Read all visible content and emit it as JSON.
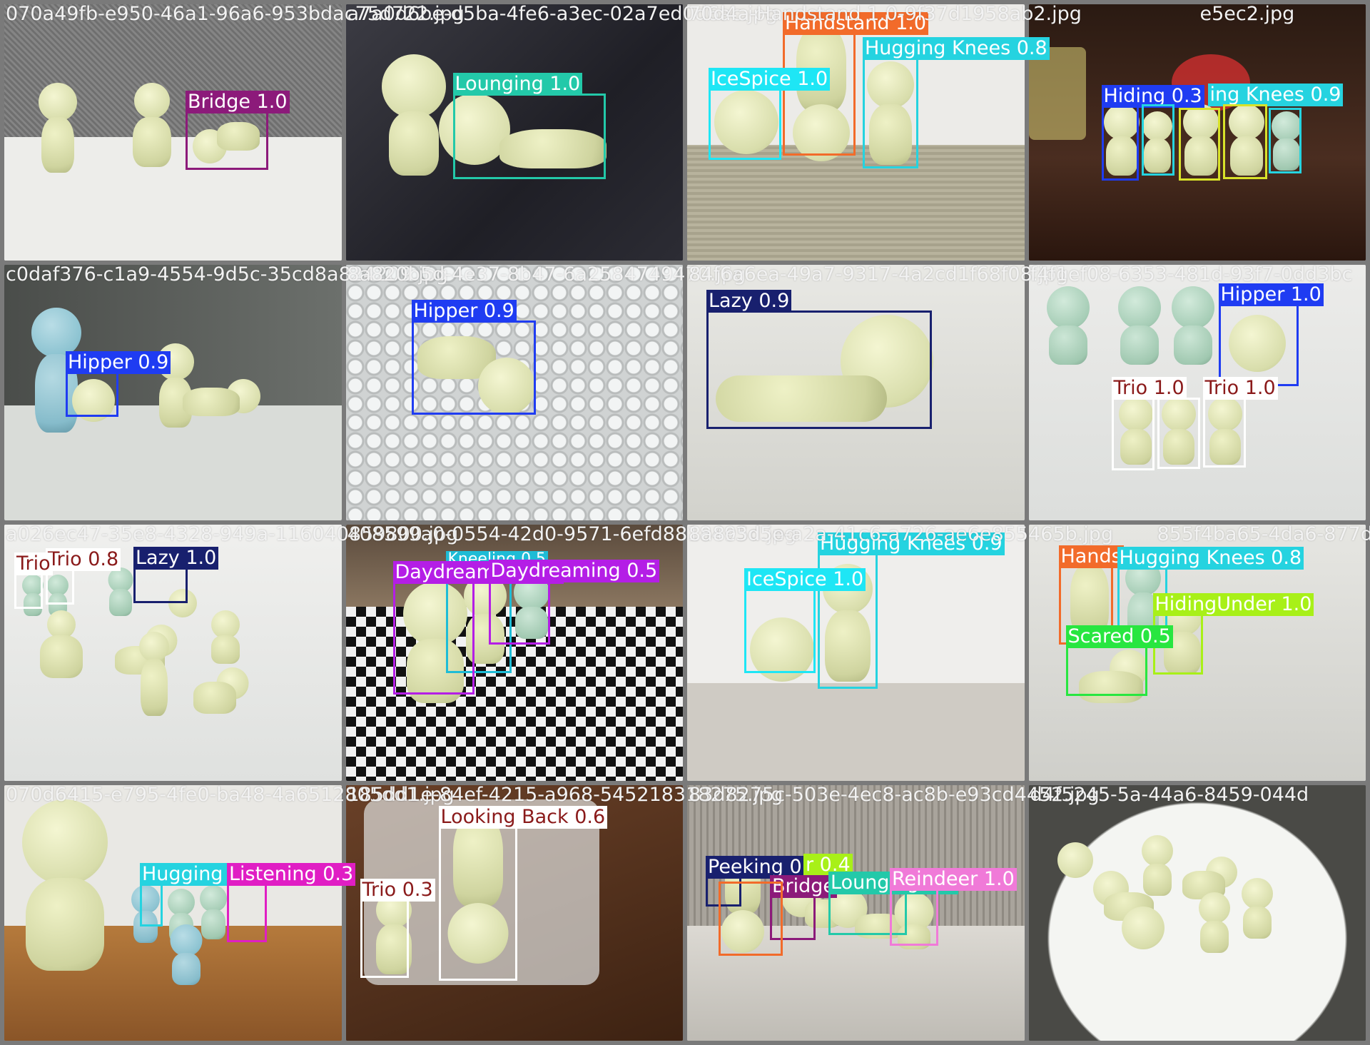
{
  "tiles": [
    {
      "filename": "070a49fb-e950-46a1-96a6-953bdac75d722.jpg",
      "detections": [
        {
          "label": "Bridge 1.0",
          "color": "#8c1a7a"
        }
      ]
    },
    {
      "filename": "a7a0d6be-d5ba-4fe6-a3ec-02a7ed0d6ac.jpg",
      "detections": [
        {
          "label": "Lounging 1.0",
          "color": "#23c9a9"
        }
      ]
    },
    {
      "filename": "70d4a-Handstand 1.0-9f37d1958ab2.jpg",
      "detections": [
        {
          "label": "Handstand 1.0",
          "color": "#f26b2a"
        },
        {
          "label": "Hugging Knees 0.8",
          "color": "#25d3e0"
        },
        {
          "label": "IceSpice 1.0",
          "color": "#1ee6f5"
        }
      ]
    },
    {
      "filename": "e5ec2.jpg",
      "detections": [
        {
          "label": "Hiding 0.3",
          "color": "#1f3cf2"
        },
        {
          "label": "ing Knees 0.9",
          "color": "#25d3e0"
        },
        {
          "label": "",
          "color": "#d8e22a"
        },
        {
          "label": "",
          "color": "#d8e22a"
        },
        {
          "label": "",
          "color": "#25d3e0"
        }
      ]
    },
    {
      "filename": "c0daf376-c1a9-4554-9d5c-35cd8a824209.jpg",
      "detections": [
        {
          "label": "Hipper 0.9",
          "color": "#1f3cf2"
        }
      ]
    },
    {
      "filename": "8a820b5d-4e37-8b47-6a2584749470.jpg",
      "detections": [
        {
          "label": "Hipper 0.9",
          "color": "#1f3cf2"
        }
      ]
    },
    {
      "filename": "84f6a6ea-49a7-9317-4a2cd1f68f08.jpg",
      "detections": [
        {
          "label": "Lazy 0.9",
          "color": "#18206e"
        }
      ]
    },
    {
      "filename": "f4f1ef08-6353-481d-93f7-0dd3bc",
      "detections": [
        {
          "label": "Hipper 1.0",
          "color": "#1f3cf2"
        },
        {
          "label": "Trio 1.0",
          "color": "#ffffff"
        },
        {
          "label": "Trio 1.0",
          "color": "#ffffff"
        },
        {
          "label": "",
          "color": "#ffffff"
        }
      ]
    },
    {
      "filename": "a026ec47-35e8-4328-949a-116040859800.jpg",
      "detections": [
        {
          "label": "Trio 0.8",
          "color": "#ffffff"
        },
        {
          "label": "Trio",
          "color": "#ffffff"
        },
        {
          "label": "Lazy 1.0",
          "color": "#18206e"
        }
      ]
    },
    {
      "filename": "408599a0-0554-42d0-9571-6efd8818495d.jpg",
      "detections": [
        {
          "label": "Kneeling 0.5",
          "color": "#1ebcd6"
        },
        {
          "label": "Daydreaming 0.4",
          "color": "#b41ee6"
        },
        {
          "label": "Daydreaming 0.5",
          "color": "#b41ee6"
        }
      ]
    },
    {
      "filename": "8a8c3d5e-a2a-41c6-a726-ae6e855465b.jpg",
      "detections": [
        {
          "label": "Hugging Knees 0.9",
          "color": "#25d3e0"
        },
        {
          "label": "IceSpice 1.0",
          "color": "#1ee6f5"
        }
      ]
    },
    {
      "filename": "855f4ba65-4da6-877d-10ab",
      "detections": [
        {
          "label": "Hands",
          "color": "#f26b2a"
        },
        {
          "label": "Hugging Knees 0.8",
          "color": "#25d3e0"
        },
        {
          "label": "HidingUnder 1.0",
          "color": "#a8f018"
        },
        {
          "label": "Scared 0.5",
          "color": "#28e640"
        }
      ]
    },
    {
      "filename": "070d6415-e795-4fe0-ba48-4a6512805dd1.jpg",
      "detections": [
        {
          "label": "Hugging K",
          "color": "#25d3e0"
        },
        {
          "label": "Listening 0.3",
          "color": "#e01ec4"
        }
      ]
    },
    {
      "filename": "185dd1e-84ef-4215-a968-545218318275.jpg",
      "detections": [
        {
          "label": "Looking Back 0.6",
          "color": "#ffffff"
        },
        {
          "label": "Trio 0.3",
          "color": "#ffffff"
        }
      ]
    },
    {
      "filename": "83d8275c-503e-4ec8-ac8b-e93cd4452.jpg",
      "detections": [
        {
          "label": "Peeking 0.3",
          "color": "#18206e"
        },
        {
          "label": "r 0.4",
          "color": "#a8f018"
        },
        {
          "label": "Bridge",
          "color": "#8c1a7a"
        },
        {
          "label": "Lounging 1.0",
          "color": "#23c9a9"
        },
        {
          "label": "Reindeer 1.0",
          "color": "#f07ad8"
        },
        {
          "label": "",
          "color": "#f26b2a"
        }
      ]
    },
    {
      "filename": "d4f5245-5a-44a6-8459-044d",
      "detections": []
    }
  ]
}
